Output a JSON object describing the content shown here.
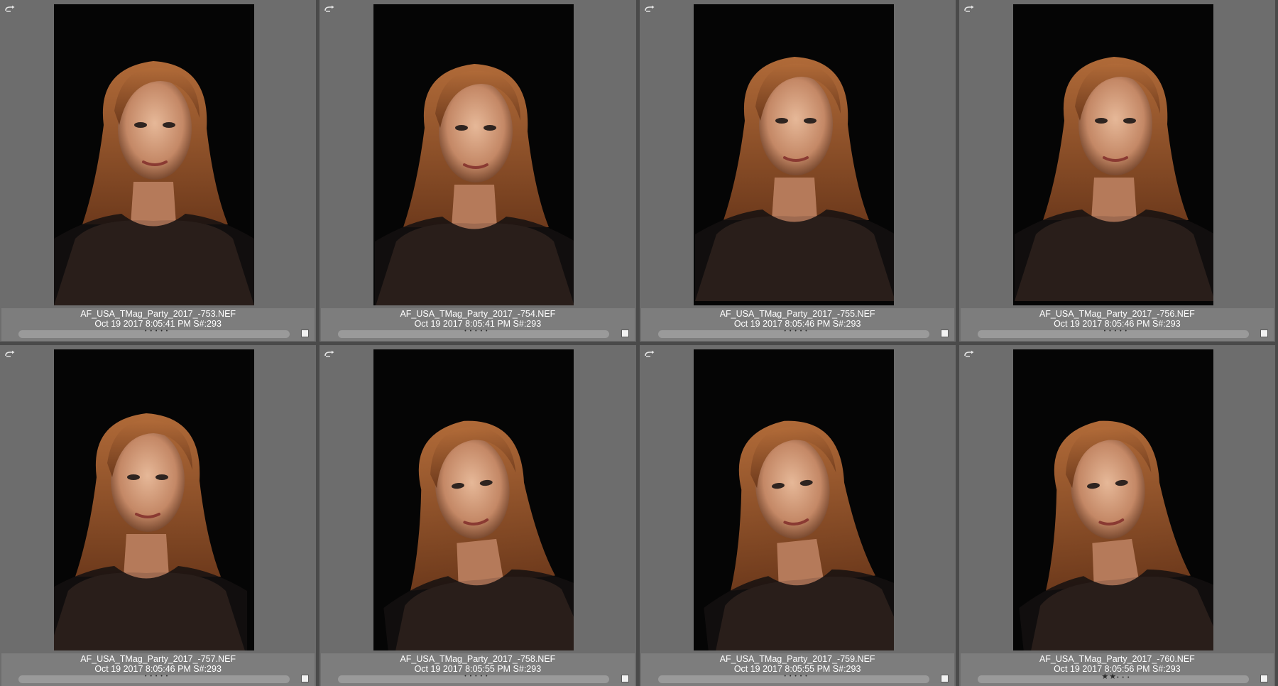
{
  "colors": {
    "background": "#4a4a4a",
    "cell": "#6d6d6d",
    "meta_bar": "#7d7d7d",
    "hair": "#a0582c",
    "skin": "#d8a684"
  },
  "icons": {
    "rotate": "rotate-icon",
    "checkbox": "checkbox"
  },
  "thumbnails": [
    {
      "filename": "AF_USA_TMag_Party_2017_-753.NEF",
      "datetime": "Oct 19 2017 8:05:41 PM S#:293",
      "rating": 0
    },
    {
      "filename": "AF_USA_TMag_Party_2017_-754.NEF",
      "datetime": "Oct 19 2017 8:05:41 PM S#:293",
      "rating": 0
    },
    {
      "filename": "AF_USA_TMag_Party_2017_-755.NEF",
      "datetime": "Oct 19 2017 8:05:46 PM S#:293",
      "rating": 0
    },
    {
      "filename": "AF_USA_TMag_Party_2017_-756.NEF",
      "datetime": "Oct 19 2017 8:05:46 PM S#:293",
      "rating": 0
    },
    {
      "filename": "AF_USA_TMag_Party_2017_-757.NEF",
      "datetime": "Oct 19 2017 8:05:46 PM S#:293",
      "rating": 0
    },
    {
      "filename": "AF_USA_TMag_Party_2017_-758.NEF",
      "datetime": "Oct 19 2017 8:05:55 PM S#:293",
      "rating": 0
    },
    {
      "filename": "AF_USA_TMag_Party_2017_-759.NEF",
      "datetime": "Oct 19 2017 8:05:55 PM S#:293",
      "rating": 0
    },
    {
      "filename": "AF_USA_TMag_Party_2017_-760.NEF",
      "datetime": "Oct 19 2017 8:05:56 PM S#:293",
      "rating": 2
    }
  ]
}
